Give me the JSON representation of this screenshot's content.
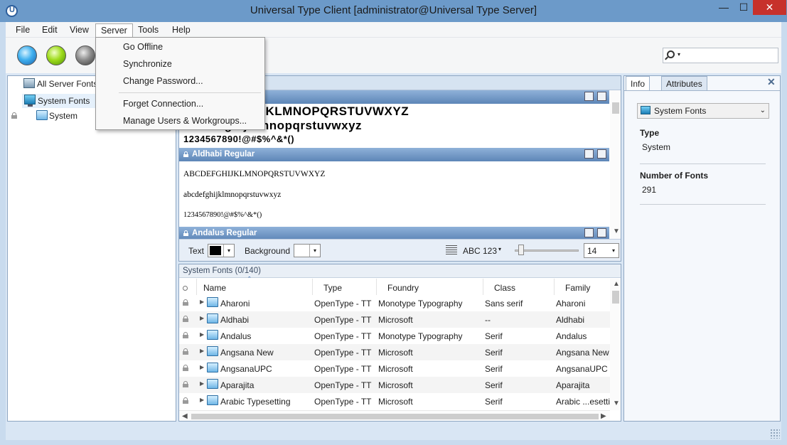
{
  "window": {
    "title": "Universal Type Client [administrator@Universal Type Server]",
    "minimize": "—",
    "maximize": "☐",
    "close": "✕"
  },
  "menubar": {
    "items": [
      "File",
      "Edit",
      "View",
      "Server",
      "Tools",
      "Help"
    ]
  },
  "server_menu": {
    "items": [
      "Go Offline",
      "Synchronize",
      "Change Password...",
      "Forget Connection...",
      "Manage Users & Workgroups..."
    ]
  },
  "search": {
    "caret": "▾",
    "value": ""
  },
  "tree": {
    "items": [
      "All Server Fonts",
      "System Fonts",
      "System"
    ]
  },
  "preview": {
    "samples_top": {
      "upper": "ABCDEFGHIJKLMNOPQRSTUVWXYZ",
      "lower": "abcdefghijklmnopqrstuvwxyz",
      "digits": "1234567890!@#$%^&*()"
    },
    "fonts": [
      {
        "name": "Aldhabi Regular",
        "upper": "ABCDEFGHIJKLMNOPQRSTUVWXYZ",
        "lower": "abcdefghijklmnopqrstuvwxyz",
        "digits": "1234567890!@#$%^&*()"
      },
      {
        "name": "Andalus Regular"
      }
    ],
    "controls": {
      "text_label": "Text",
      "background_label": "Background",
      "text_color": "#000000",
      "background_color": "#ffffff",
      "sample_mode": "ABC 123",
      "size": "14",
      "dropdown_caret": "▾",
      "size_level": 0.05
    }
  },
  "table": {
    "caption": "System Fonts (0/140)",
    "sort_indicator": "ˆ",
    "columns": [
      "Name",
      "Type",
      "Foundry",
      "Class",
      "Family"
    ],
    "rows": [
      [
        "Aharoni",
        "OpenType - TT",
        "Monotype Typography",
        "Sans serif",
        "Aharoni"
      ],
      [
        "Aldhabi",
        "OpenType - TT",
        "Microsoft",
        "--",
        "Aldhabi"
      ],
      [
        "Andalus",
        "OpenType - TT",
        "Monotype Typography",
        "Serif",
        "Andalus"
      ],
      [
        "Angsana New",
        "OpenType - TT",
        "Microsoft",
        "Serif",
        "Angsana New"
      ],
      [
        "AngsanaUPC",
        "OpenType - TT",
        "Microsoft",
        "Serif",
        "AngsanaUPC"
      ],
      [
        "Aparajita",
        "OpenType - TT",
        "Microsoft",
        "Serif",
        "Aparajita"
      ],
      [
        "Arabic Typesetting",
        "OpenType - TT",
        "Microsoft",
        "Serif",
        "Arabic ...esettir"
      ]
    ]
  },
  "info_panel": {
    "tabs": [
      "Info",
      "Attributes"
    ],
    "close": "✕",
    "selector": "System Fonts",
    "fields": [
      {
        "label": "Type",
        "value": "System"
      },
      {
        "label": "Number of Fonts",
        "value": "291"
      }
    ]
  }
}
